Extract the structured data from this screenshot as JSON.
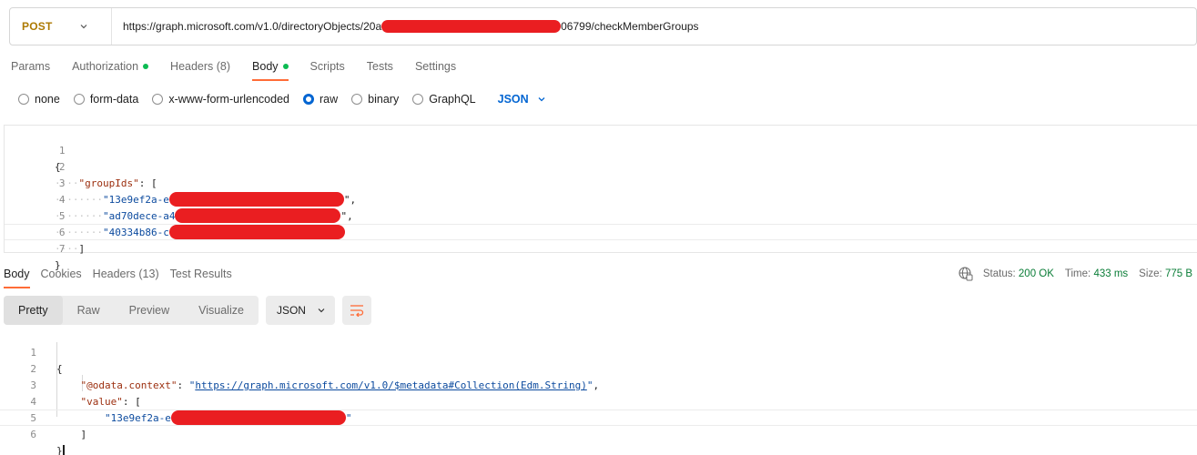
{
  "request": {
    "method": "POST",
    "url_prefix": "https://graph.microsoft.com/v1.0/directoryObjects/20a",
    "url_suffix": "06799/checkMemberGroups"
  },
  "request_tabs": [
    {
      "label": "Params",
      "active": false,
      "dot": false
    },
    {
      "label": "Authorization",
      "active": false,
      "dot": true
    },
    {
      "label": "Headers (8)",
      "active": false,
      "dot": false
    },
    {
      "label": "Body",
      "active": true,
      "dot": true
    },
    {
      "label": "Scripts",
      "active": false,
      "dot": false
    },
    {
      "label": "Tests",
      "active": false,
      "dot": false
    },
    {
      "label": "Settings",
      "active": false,
      "dot": false
    }
  ],
  "body_types": [
    {
      "label": "none",
      "checked": false
    },
    {
      "label": "form-data",
      "checked": false
    },
    {
      "label": "x-www-form-urlencoded",
      "checked": false
    },
    {
      "label": "raw",
      "checked": true
    },
    {
      "label": "binary",
      "checked": false
    },
    {
      "label": "GraphQL",
      "checked": false
    }
  ],
  "body_format": "JSON",
  "request_body": {
    "line_numbers": [
      "1",
      "2",
      "3",
      "4",
      "5",
      "6",
      "7"
    ],
    "open_brace": "{",
    "group_key": "\"groupIds\"",
    "colon_bracket": ": [",
    "id1": "\"13e9ef2a-e",
    "id2": "\"ad70dece-a4",
    "id3": "\"40334b86-c",
    "comma_quote": "\",",
    "close_bracket": "]",
    "close_brace": "}"
  },
  "response_tabs": [
    {
      "label": "Body",
      "active": true
    },
    {
      "label": "Cookies",
      "active": false
    },
    {
      "label": "Headers (13)",
      "active": false
    },
    {
      "label": "Test Results",
      "active": false
    }
  ],
  "status": {
    "status_label": "Status:",
    "status_value": "200 OK",
    "time_label": "Time:",
    "time_value": "433 ms",
    "size_label": "Size:",
    "size_value": "775 B"
  },
  "view_modes": [
    {
      "label": "Pretty",
      "active": true
    },
    {
      "label": "Raw",
      "active": false
    },
    {
      "label": "Preview",
      "active": false
    },
    {
      "label": "Visualize",
      "active": false
    }
  ],
  "response_format": "JSON",
  "response_body": {
    "line_numbers": [
      "1",
      "2",
      "3",
      "4",
      "5",
      "6"
    ],
    "open_brace": "{",
    "context_key": "\"@odata.context\"",
    "colon": ": ",
    "context_url": "https://graph.microsoft.com/v1.0/$metadata#Collection(Edm.String)",
    "value_key": "\"value\"",
    "colon_bracket": ": [",
    "id1": "\"13e9ef2a-e",
    "end_quote": "\"",
    "close_bracket": "]",
    "close_brace": "}"
  },
  "colors": {
    "accent": "#ff6c37",
    "link_blue": "#0265d2",
    "method_orange": "#ad7a03",
    "status_green": "#0a7d37",
    "redaction": "#ea1e21"
  }
}
